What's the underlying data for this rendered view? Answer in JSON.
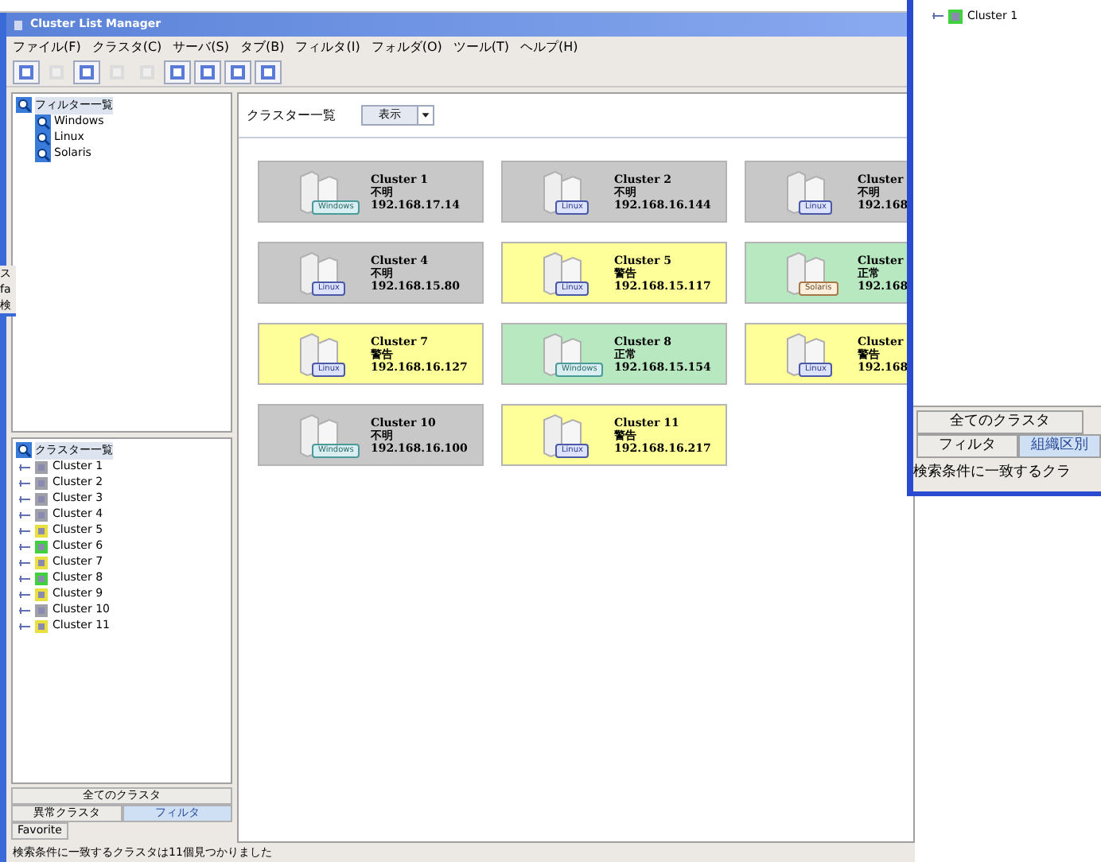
{
  "window": {
    "title": "Cluster List Manager"
  },
  "menu": [
    "ファイル(F)",
    "クラスタ(C)",
    "サーバ(S)",
    "タブ(B)",
    "フィルタ(I)",
    "フォルダ(O)",
    "ツール(T)",
    "ヘルプ(H)"
  ],
  "toolbar": [
    {
      "disabled": false
    },
    {
      "disabled": true
    },
    {
      "disabled": false
    },
    {
      "disabled": true
    },
    {
      "disabled": true
    },
    {
      "disabled": false
    },
    {
      "disabled": false
    },
    {
      "disabled": false
    },
    {
      "disabled": false
    }
  ],
  "filter_tree": {
    "label": "フィルター一覧",
    "children": [
      {
        "label": "Windows"
      },
      {
        "label": "Linux"
      },
      {
        "label": "Solaris"
      }
    ]
  },
  "cluster_tree": {
    "label": "クラスター一覧",
    "children": [
      {
        "label": "Cluster 1",
        "color": "#a0a0a8"
      },
      {
        "label": "Cluster 2",
        "color": "#a0a0a8"
      },
      {
        "label": "Cluster 3",
        "color": "#a0a0a8"
      },
      {
        "label": "Cluster 4",
        "color": "#a0a0a8"
      },
      {
        "label": "Cluster 5",
        "color": "#e8e040"
      },
      {
        "label": "Cluster 6",
        "color": "#40d040"
      },
      {
        "label": "Cluster 7",
        "color": "#e8e040"
      },
      {
        "label": "Cluster 8",
        "color": "#40d040"
      },
      {
        "label": "Cluster 9",
        "color": "#e8e040"
      },
      {
        "label": "Cluster 10",
        "color": "#a0a0a8"
      },
      {
        "label": "Cluster 11",
        "color": "#e8e040"
      }
    ]
  },
  "left_tabs": [
    {
      "label": "全てのクラスタ",
      "selected": false
    },
    {
      "label": "異常クラスタ",
      "selected": false
    },
    {
      "label": "フィルタ",
      "selected": true
    },
    {
      "label": "Favorite",
      "selected": false
    }
  ],
  "content": {
    "title": "クラスター一覧",
    "view_select": "表示",
    "cards": [
      {
        "name": "Cluster 1",
        "status": "不明",
        "ip": "192.168.17.14",
        "os": "Windows",
        "color": "#c8c8c8"
      },
      {
        "name": "Cluster 2",
        "status": "不明",
        "ip": "192.168.16.144",
        "os": "Linux",
        "color": "#c8c8c8"
      },
      {
        "name": "Cluster",
        "status": "不明",
        "ip": "192.168",
        "os": "Linux",
        "color": "#c8c8c8"
      },
      {
        "name": "Cluster 4",
        "status": "不明",
        "ip": "192.168.15.80",
        "os": "Linux",
        "color": "#c8c8c8"
      },
      {
        "name": "Cluster 5",
        "status": "警告",
        "ip": "192.168.15.117",
        "os": "Linux",
        "color": "#ffff99"
      },
      {
        "name": "Cluster",
        "status": "正常",
        "ip": "192.168",
        "os": "Solaris",
        "color": "#b8e8c0"
      },
      {
        "name": "Cluster 7",
        "status": "警告",
        "ip": "192.168.16.127",
        "os": "Linux",
        "color": "#ffff99"
      },
      {
        "name": "Cluster 8",
        "status": "正常",
        "ip": "192.168.15.154",
        "os": "Windows",
        "color": "#b8e8c0"
      },
      {
        "name": "Cluster",
        "status": "警告",
        "ip": "192.168",
        "os": "Linux",
        "color": "#ffff99"
      },
      {
        "name": "Cluster 10",
        "status": "不明",
        "ip": "192.168.16.100",
        "os": "Windows",
        "color": "#c8c8c8"
      },
      {
        "name": "Cluster 11",
        "status": "警告",
        "ip": "192.168.16.217",
        "os": "Linux",
        "color": "#ffff99"
      }
    ]
  },
  "status_bar": "検索条件に一致するクラスタは11個見つかりました",
  "back_window": {
    "tree_item": "Cluster 1",
    "tabs": [
      {
        "label": "全てのクラスタ",
        "selected": false
      },
      {
        "label": "フィルタ",
        "selected": false
      },
      {
        "label": "組織区別",
        "selected": true
      }
    ],
    "status_bar": "検索条件に一致するクラ"
  },
  "left_fragment": [
    "ス",
    "fa",
    "検"
  ]
}
